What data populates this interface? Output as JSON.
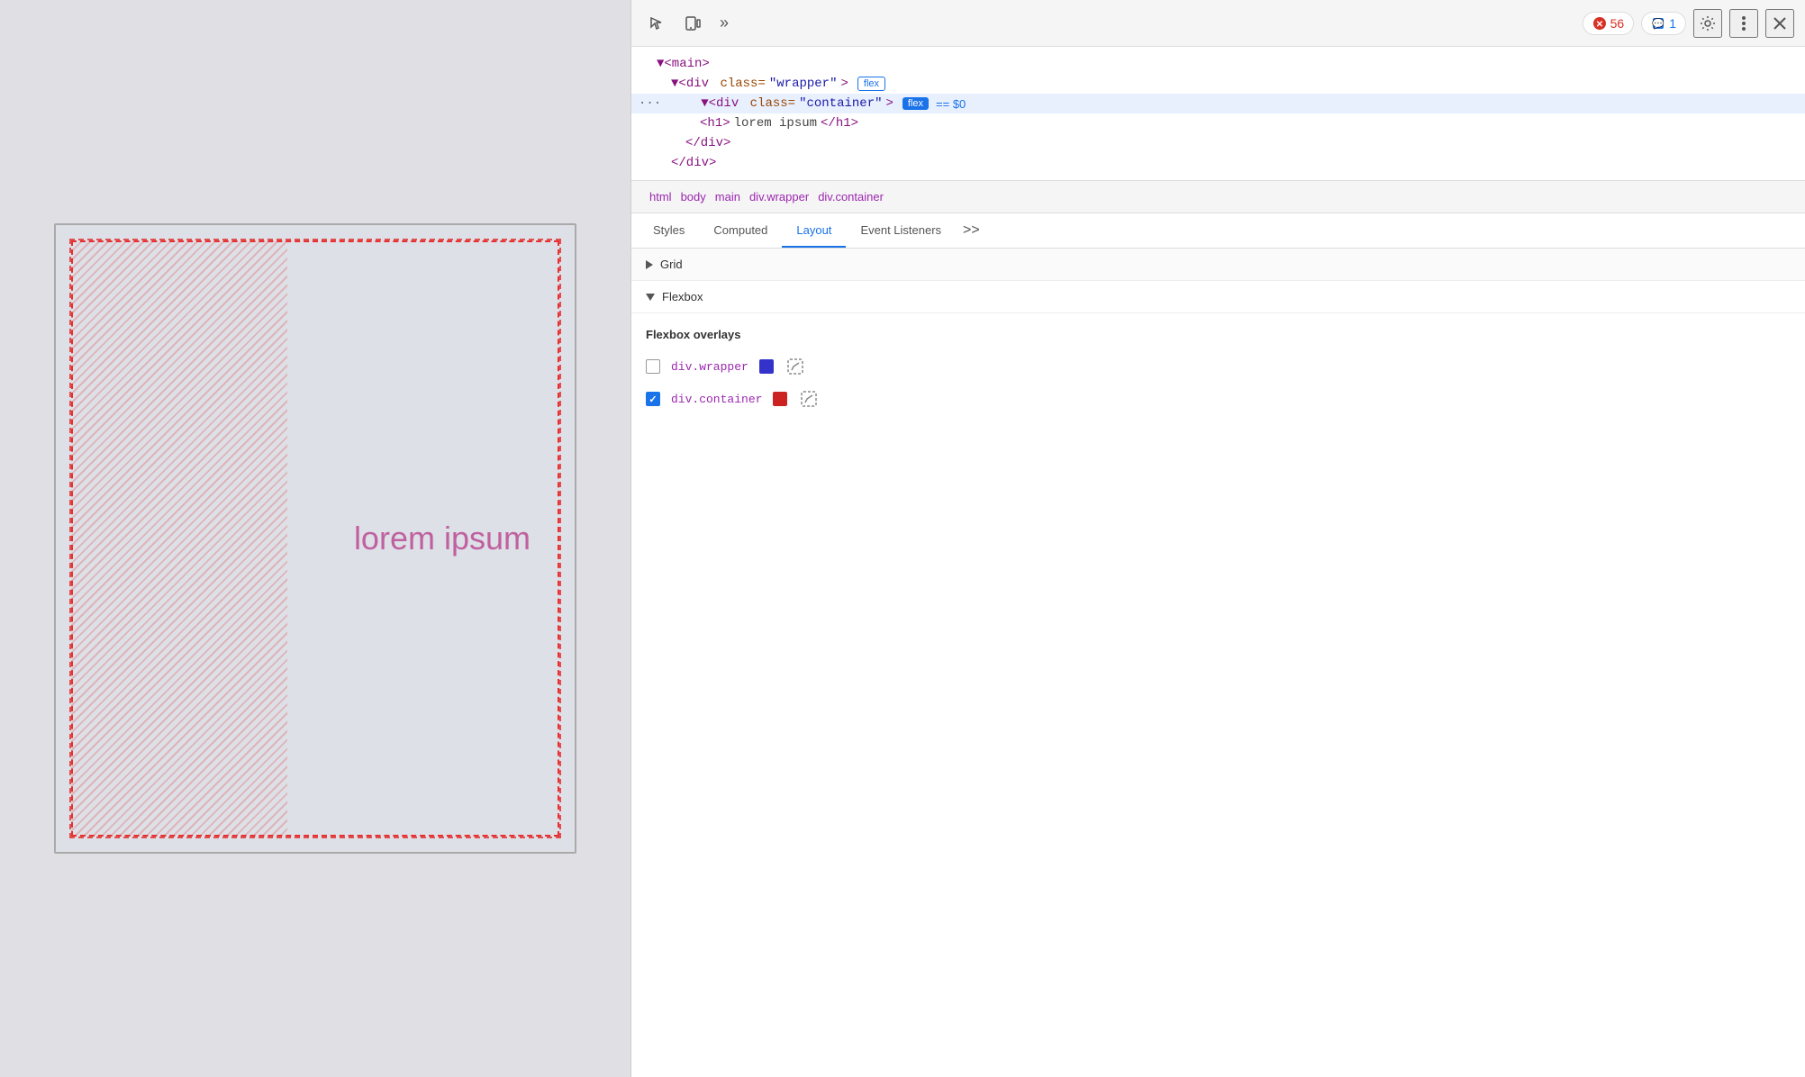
{
  "preview": {
    "lorem_ipsum": "lorem ipsum"
  },
  "devtools": {
    "toolbar": {
      "inspect_label": "🖱",
      "device_label": "📱",
      "more_label": "»",
      "error_count": "56",
      "warning_count": "1",
      "settings_label": "⚙",
      "dots_label": "⋮",
      "close_label": "✕"
    },
    "html_tree": {
      "line1": "▼<main>",
      "line2_prefix": "▼",
      "line2_tag": "div",
      "line2_attr": "class",
      "line2_val": "wrapper",
      "line2_badge": "flex",
      "line3_ellipsis": "···",
      "line3_prefix": "▼",
      "line3_tag": "div",
      "line3_attr": "class",
      "line3_val": "container",
      "line3_badge": "flex",
      "line3_dollar": "== $0",
      "line4": "<h1>lorem ipsum</h1>",
      "line5": "</div>",
      "line6": "</div>"
    },
    "breadcrumb": {
      "items": [
        "html",
        "body",
        "main",
        "div.wrapper",
        "div.container"
      ]
    },
    "tabs": {
      "items": [
        "Styles",
        "Computed",
        "Layout",
        "Event Listeners"
      ],
      "active": "Layout",
      "more": ">>"
    },
    "layout": {
      "grid_label": "Grid",
      "flexbox_label": "Flexbox",
      "overlays_title": "Flexbox overlays",
      "overlay1": {
        "label": "div.wrapper",
        "color": "#3333cc",
        "checked": false
      },
      "overlay2": {
        "label": "div.container",
        "color": "#cc2222",
        "checked": true
      }
    }
  }
}
